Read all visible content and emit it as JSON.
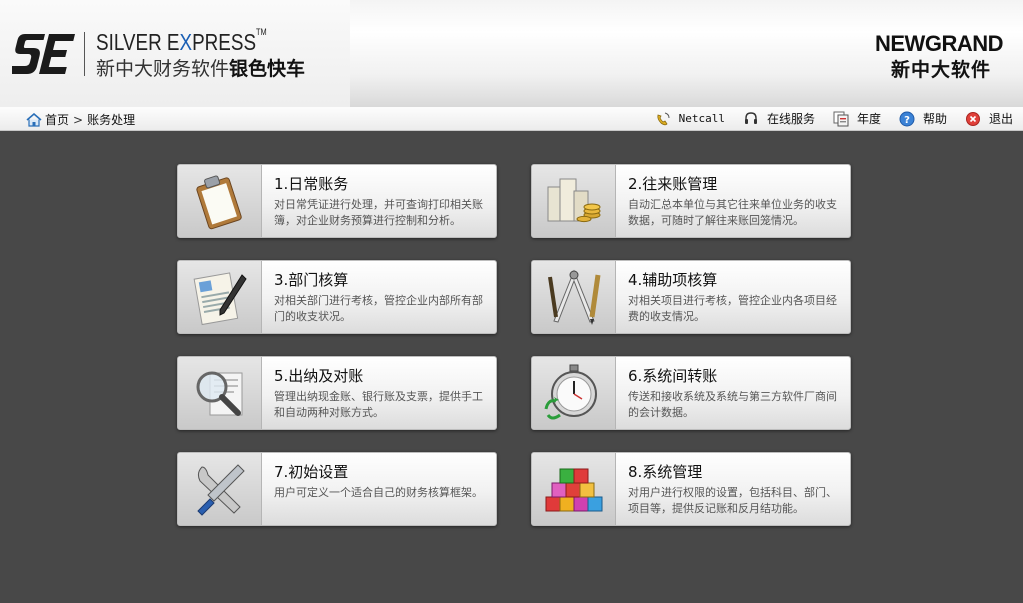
{
  "header": {
    "logo_mark": "SE",
    "product_en_pre": "SILVER E",
    "product_en_x": "X",
    "product_en_post": "PRESS",
    "product_tm": "TM",
    "product_cn_pre": "新中大财务软件",
    "product_cn_bold": "银色快车",
    "brand_en": "NEWGRAND",
    "brand_cn": "新中大软件"
  },
  "breadcrumb": {
    "home": "首页",
    "separator": ">",
    "current": "账务处理"
  },
  "toolbar": {
    "netcall": "Netcall",
    "online_service": "在线服务",
    "year": "年度",
    "help": "帮助",
    "exit": "退出"
  },
  "modules": [
    {
      "title": "1.日常账务",
      "desc": "对日常凭证进行处理，并可查询打印相关账簿，对企业财务预算进行控制和分析。",
      "icon": "clipboard-icon"
    },
    {
      "title": "2.往来账管理",
      "desc": "自动汇总本单位与其它往来单位业务的收支数据，可随时了解往来账回笼情况。",
      "icon": "money-stack-icon"
    },
    {
      "title": "3.部门核算",
      "desc": "对相关部门进行考核，管控企业内部所有部门的收支状况。",
      "icon": "document-pen-icon"
    },
    {
      "title": "4.辅助项核算",
      "desc": "对相关项目进行考核，管控企业内各项目经费的收支情况。",
      "icon": "drafting-tools-icon"
    },
    {
      "title": "5.出纳及对账",
      "desc": "管理出纳现金账、银行账及支票，提供手工和自动两种对账方式。",
      "icon": "magnifier-document-icon"
    },
    {
      "title": "6.系统间转账",
      "desc": "传送和接收系统及系统与第三方软件厂商间的会计数据。",
      "icon": "stopwatch-icon"
    },
    {
      "title": "7.初始设置",
      "desc": "用户可定义一个适合自己的财务核算框架。",
      "icon": "tools-icon"
    },
    {
      "title": "8.系统管理",
      "desc": "对用户进行权限的设置，包括科目、部门、项目等，提供反记账和反月结功能。",
      "icon": "colored-blocks-icon"
    }
  ],
  "colors": {
    "main_background": "#484848",
    "accent_blue": "#1a5fb4"
  }
}
